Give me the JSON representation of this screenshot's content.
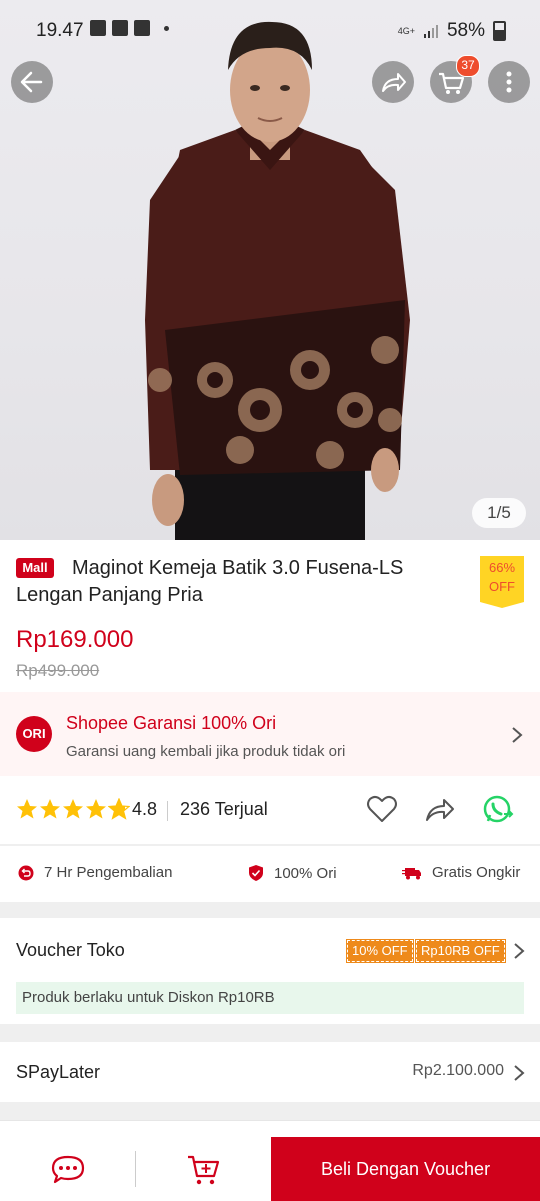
{
  "status": {
    "time": "19.47",
    "network": "4G+",
    "battery": "58%"
  },
  "product": {
    "image_counter": "1/5",
    "mall_badge": "Mall",
    "title": "Maginot Kemeja Batik 3.0 Fusena-LS Lengan Panjang Pria",
    "discount_pct": "66%",
    "discount_off": "OFF",
    "price": "Rp169.000",
    "original_price": "Rp499.000"
  },
  "header": {
    "cart_count": "37"
  },
  "guarantee": {
    "icon_text": "ORI",
    "title": "Shopee Garansi 100% Ori",
    "subtitle": "Garansi uang kembali jika produk tidak ori"
  },
  "rating": {
    "score": "4.8",
    "stars": 4.8,
    "sold": "236 Terjual"
  },
  "features": [
    {
      "label": "7 Hr Pengembalian",
      "icon": "return-icon"
    },
    {
      "label": "100% Ori",
      "icon": "shield-check-icon"
    },
    {
      "label": "Gratis Ongkir",
      "icon": "truck-icon"
    }
  ],
  "voucher": {
    "label": "Voucher Toko",
    "tags": [
      "10% OFF",
      "Rp10RB OFF"
    ],
    "info": "Produk berlaku untuk Diskon Rp10RB"
  },
  "spaylater": {
    "label": "SPayLater",
    "value": "Rp2.100.000"
  },
  "bottom": {
    "buy_label": "Beli Dengan Voucher"
  },
  "colors": {
    "accent": "#d0011b",
    "shopee_orange": "#ee4d2d",
    "star": "#ffc107",
    "discount_bg": "#ffd424",
    "voucher_tag": "#ee8a1b",
    "whatsapp": "#25d366"
  }
}
